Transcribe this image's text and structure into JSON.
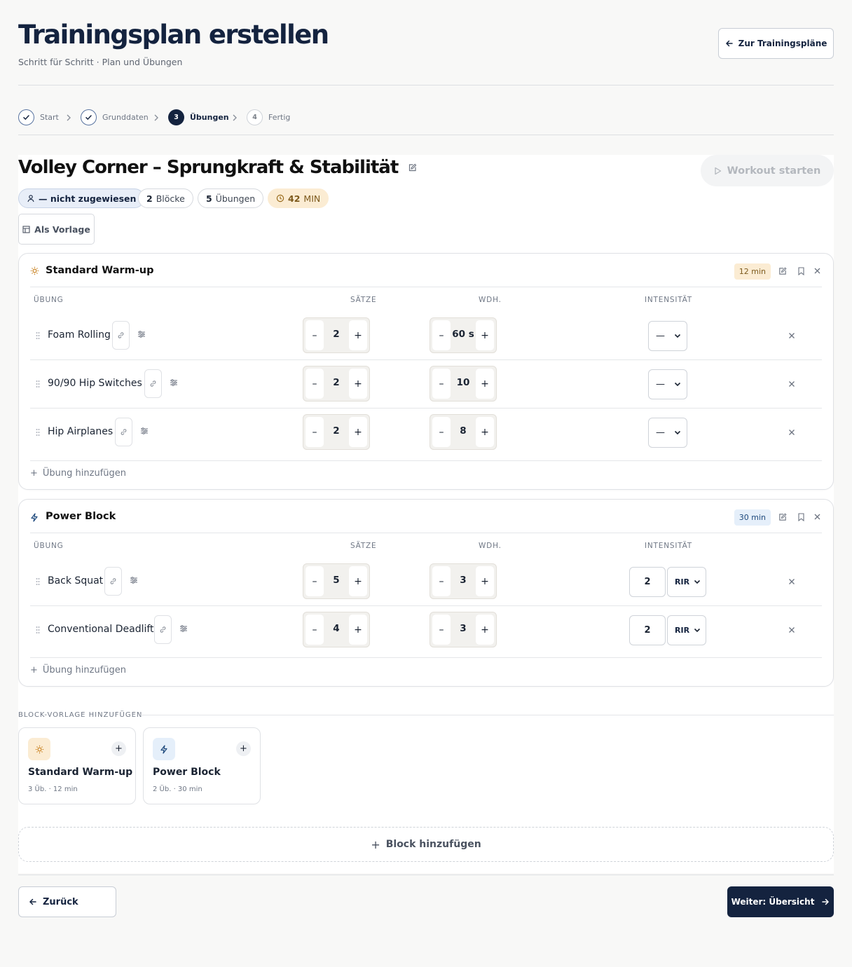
{
  "header": {
    "title": "Trainingsplan erstellen",
    "subtitle": "Schritt für Schritt · Plan und Übungen",
    "back_to_plans_label": "Zur Trainingspläne"
  },
  "stepper": {
    "steps": [
      {
        "label": "Start",
        "state": "done"
      },
      {
        "label": "Grunddaten",
        "state": "done"
      },
      {
        "number": "3",
        "label": "Übungen",
        "state": "active"
      },
      {
        "number": "4",
        "label": "Fertig",
        "state": "todo"
      }
    ]
  },
  "plan": {
    "title": "Volley Corner – Sprungkraft & Stabilität",
    "workout_start_label": "Workout starten",
    "assignee": "— nicht zugewiesen",
    "blocks_count": "2",
    "blocks_label": "Blöcke",
    "exercises_count": "5",
    "exercises_label": "Übungen",
    "duration_value": "42",
    "duration_unit": "MIN",
    "as_template_label": "Als Vorlage"
  },
  "columns": {
    "exercise": "ÜBUNG",
    "sets": "SÄTZE",
    "reps": "WDH.",
    "intensity": "INTENSITÄT"
  },
  "blocks": [
    {
      "title": "Standard Warm-up",
      "icon": "sun-icon",
      "duration": "12 min",
      "add_exercise_label": "Übung hinzufügen",
      "exercises": [
        {
          "name": "Foam Rolling",
          "sets": "2",
          "reps": "60 s",
          "intensity": "—"
        },
        {
          "name": "90/90 Hip Switches",
          "sets": "2",
          "reps": "10",
          "intensity": "—"
        },
        {
          "name": "Hip Airplanes",
          "sets": "2",
          "reps": "8",
          "intensity": "—"
        }
      ]
    },
    {
      "title": "Power Block",
      "icon": "lightning-icon",
      "duration": "30 min",
      "add_exercise_label": "Übung hinzufügen",
      "exercises": [
        {
          "name": "Back Squat",
          "sets": "5",
          "reps": "3",
          "intensity_value": "2",
          "intensity_unit": "RIR"
        },
        {
          "name": "Conventional Deadlift",
          "sets": "4",
          "reps": "3",
          "intensity_value": "2",
          "intensity_unit": "RIR"
        }
      ]
    }
  ],
  "templates": {
    "heading": "BLOCK-VORLAGE HINZUFÜGEN",
    "items": [
      {
        "name": "Standard Warm-up",
        "meta": "3 Üb. · 12 min",
        "icon": "sun-icon"
      },
      {
        "name": "Power Block",
        "meta": "2 Üb. · 30 min",
        "icon": "lightning-icon"
      }
    ]
  },
  "add_block_label": "Block hinzufügen",
  "footer": {
    "back_label": "Zurück",
    "next_label": "Weiter: Übersicht"
  },
  "colors": {
    "primary": "#14233f",
    "warm_badge": "#fbecd3",
    "power_badge": "#e5effa",
    "page_bg": "#f8f8f7"
  }
}
